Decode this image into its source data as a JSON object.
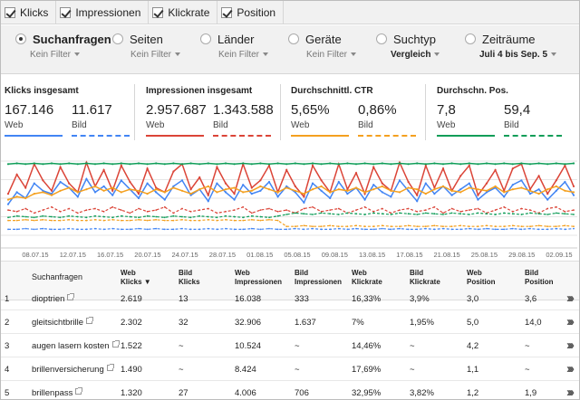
{
  "metrics": [
    {
      "label": "Klicks",
      "checked": true
    },
    {
      "label": "Impressionen",
      "checked": true
    },
    {
      "label": "Klickrate",
      "checked": true
    },
    {
      "label": "Position",
      "checked": true
    }
  ],
  "dimensions": [
    {
      "label": "Suchanfragen",
      "sub": "Kein Filter",
      "selected": true
    },
    {
      "label": "Seiten",
      "sub": "Kein Filter",
      "selected": false
    },
    {
      "label": "Länder",
      "sub": "Kein Filter",
      "selected": false
    },
    {
      "label": "Geräte",
      "sub": "Kein Filter",
      "selected": false
    },
    {
      "label": "Suchtyp",
      "sub": "Vergleich",
      "selected": false
    },
    {
      "label": "Zeiträume",
      "sub": "Juli 4 bis Sep. 5",
      "selected": false
    }
  ],
  "summary": [
    {
      "title": "Klicks insgesamt",
      "web": "167.146",
      "bild": "11.617",
      "web_label": "Web",
      "bild_label": "Bild",
      "color": "#4285f4"
    },
    {
      "title": "Impressionen insgesamt",
      "web": "2.957.687",
      "bild": "1.343.588",
      "web_label": "Web",
      "bild_label": "Bild",
      "color": "#db4437"
    },
    {
      "title": "Durchschnittl. CTR",
      "web": "5,65%",
      "bild": "0,86%",
      "web_label": "Web",
      "bild_label": "Bild",
      "color": "#f4a01f"
    },
    {
      "title": "Durchschn. Pos.",
      "web": "7,8",
      "bild": "59,4",
      "web_label": "Web",
      "bild_label": "Bild",
      "color": "#0f9d58"
    }
  ],
  "chart_data": {
    "type": "line",
    "categories": [
      "08.07.15",
      "12.07.15",
      "16.07.15",
      "20.07.15",
      "24.07.15",
      "28.07.15",
      "01.08.15",
      "05.08.15",
      "09.08.15",
      "13.08.15",
      "17.08.15",
      "21.08.15",
      "25.08.15",
      "29.08.15",
      "02.09.15"
    ],
    "series": [
      {
        "name": "Klicks Web",
        "color": "#4285f4",
        "style": "solid",
        "values": [
          42,
          58,
          50,
          70,
          60,
          56,
          72,
          64,
          52,
          76,
          58,
          66,
          54,
          74,
          62,
          50,
          70,
          58,
          48,
          66,
          74,
          54,
          62,
          46,
          70,
          58,
          48,
          68,
          56,
          60,
          72,
          52,
          66,
          58,
          44,
          70,
          60,
          50,
          72,
          56,
          64,
          48,
          68,
          58,
          52,
          74,
          60,
          46,
          70,
          56,
          66,
          54,
          62,
          70,
          48,
          58,
          64,
          52,
          68,
          74,
          56,
          62,
          48,
          60,
          72,
          54
        ]
      },
      {
        "name": "Klicks Bild",
        "color": "#4285f4",
        "style": "dashed",
        "values": [
          8,
          8,
          9,
          8,
          9,
          8,
          8,
          9,
          8,
          8,
          9,
          8,
          9,
          8,
          8,
          9,
          8,
          9,
          8,
          8,
          9,
          8,
          8,
          9,
          8,
          9,
          8,
          8,
          9,
          8,
          9,
          8,
          8,
          9,
          8,
          9,
          8,
          8,
          9,
          8,
          9,
          8,
          8,
          9,
          8,
          9,
          8,
          8,
          9,
          8,
          9,
          8,
          8,
          9,
          8,
          9,
          8,
          8,
          9,
          8,
          9,
          8,
          8,
          9,
          8,
          9
        ]
      },
      {
        "name": "Impressionen Web",
        "color": "#db4437",
        "style": "solid",
        "values": [
          56,
          82,
          64,
          96,
          74,
          60,
          92,
          70,
          58,
          98,
          66,
          88,
          60,
          94,
          72,
          56,
          90,
          64,
          58,
          86,
          96,
          62,
          78,
          54,
          92,
          70,
          56,
          96,
          64,
          74,
          94,
          58,
          88,
          66,
          52,
          94,
          74,
          58,
          96,
          62,
          84,
          56,
          92,
          70,
          60,
          98,
          72,
          54,
          94,
          64,
          90,
          60,
          80,
          94,
          54,
          70,
          88,
          60,
          90,
          96,
          62,
          80,
          56,
          74,
          94,
          66
        ]
      },
      {
        "name": "Impressionen Bild",
        "color": "#db4437",
        "style": "dashed",
        "values": [
          34,
          32,
          36,
          30,
          34,
          38,
          32,
          36,
          30,
          34,
          36,
          32,
          38,
          34,
          30,
          36,
          32,
          34,
          38,
          30,
          36,
          32,
          34,
          36,
          30,
          32,
          34,
          38,
          30,
          34,
          36,
          32,
          34,
          30,
          36,
          38,
          32,
          34,
          36,
          30,
          34,
          38,
          32,
          36,
          30,
          34,
          36,
          32,
          34,
          38,
          30,
          36,
          32,
          34,
          36,
          30,
          34,
          38,
          32,
          36,
          34,
          30,
          36,
          38,
          32,
          34
        ]
      },
      {
        "name": "CTR Web",
        "color": "#f4a01f",
        "style": "solid",
        "values": [
          48,
          52,
          50,
          56,
          58,
          54,
          60,
          64,
          58,
          62,
          66,
          60,
          64,
          58,
          62,
          60,
          56,
          62,
          58,
          64,
          60,
          56,
          62,
          66,
          58,
          62,
          64,
          58,
          60,
          66,
          62,
          58,
          64,
          60,
          56,
          62,
          66,
          58,
          62,
          60,
          64,
          58,
          62,
          66,
          60,
          58,
          64,
          62,
          56,
          62,
          66,
          60,
          58,
          64,
          62,
          60,
          66,
          58,
          62,
          64,
          60,
          56,
          62,
          66,
          60,
          58
        ]
      },
      {
        "name": "CTR Bild",
        "color": "#f4a01f",
        "style": "dashed",
        "values": [
          20,
          20,
          21,
          20,
          21,
          20,
          20,
          21,
          20,
          20,
          21,
          20,
          21,
          20,
          20,
          21,
          20,
          21,
          20,
          20,
          21,
          20,
          20,
          21,
          20,
          21,
          20,
          20,
          21,
          20,
          21,
          20,
          12,
          12,
          13,
          12,
          12,
          13,
          12,
          12,
          13,
          12,
          12,
          13,
          12,
          12,
          13,
          12,
          12,
          13,
          12,
          12,
          13,
          12,
          12,
          13,
          12,
          12,
          13,
          12,
          12,
          13,
          12,
          12,
          13,
          12
        ]
      },
      {
        "name": "Position Web",
        "color": "#0f9d58",
        "style": "solid",
        "values": [
          96,
          97,
          96,
          97,
          96,
          97,
          96,
          97,
          96,
          97,
          96,
          97,
          96,
          97,
          96,
          97,
          96,
          97,
          96,
          97,
          96,
          97,
          96,
          97,
          96,
          97,
          96,
          97,
          96,
          97,
          96,
          97,
          96,
          97,
          96,
          97,
          96,
          97,
          96,
          97,
          96,
          97,
          96,
          97,
          96,
          97,
          96,
          97,
          96,
          97,
          96,
          97,
          96,
          97,
          96,
          97,
          96,
          97,
          96,
          97,
          96,
          97,
          96,
          97,
          96,
          97
        ]
      },
      {
        "name": "Position Bild",
        "color": "#0f9d58",
        "style": "dashed",
        "values": [
          24,
          26,
          25,
          24,
          26,
          25,
          24,
          26,
          25,
          24,
          26,
          25,
          24,
          26,
          25,
          24,
          26,
          25,
          24,
          26,
          25,
          24,
          26,
          25,
          24,
          26,
          25,
          24,
          26,
          25,
          24,
          26,
          28,
          30,
          29,
          28,
          30,
          29,
          28,
          30,
          29,
          28,
          30,
          29,
          28,
          30,
          29,
          28,
          30,
          29,
          28,
          30,
          29,
          28,
          30,
          29,
          28,
          30,
          29,
          28,
          30,
          29,
          28,
          30,
          29,
          28
        ]
      }
    ],
    "ylim": [
      0,
      100
    ],
    "grid": true
  },
  "table": {
    "headers": [
      {
        "label": "Suchanfragen",
        "bold": false
      },
      {
        "label": "Web\nKlicks ▼",
        "bold": true
      },
      {
        "label": "Bild\nKlicks",
        "bold": true
      },
      {
        "label": "Web\nImpressionen",
        "bold": true
      },
      {
        "label": "Bild\nImpressionen",
        "bold": true
      },
      {
        "label": "Web\nKlickrate",
        "bold": true
      },
      {
        "label": "Bild\nKlickrate",
        "bold": true
      },
      {
        "label": "Web\nPosition",
        "bold": true
      },
      {
        "label": "Bild\nPosition",
        "bold": true
      }
    ],
    "rows": [
      {
        "n": "1",
        "query": "dioptrien",
        "web_klicks": "2.619",
        "bild_klicks": "13",
        "web_impr": "16.038",
        "bild_impr": "333",
        "web_ctr": "16,33%",
        "bild_ctr": "3,9%",
        "web_pos": "3,0",
        "bild_pos": "3,6"
      },
      {
        "n": "2",
        "query": "gleitsichtbrille",
        "web_klicks": "2.302",
        "bild_klicks": "32",
        "web_impr": "32.906",
        "bild_impr": "1.637",
        "web_ctr": "7%",
        "bild_ctr": "1,95%",
        "web_pos": "5,0",
        "bild_pos": "14,0"
      },
      {
        "n": "3",
        "query": "augen lasern kosten",
        "web_klicks": "1.522",
        "bild_klicks": "~",
        "web_impr": "10.524",
        "bild_impr": "~",
        "web_ctr": "14,46%",
        "bild_ctr": "~",
        "web_pos": "4,2",
        "bild_pos": "~"
      },
      {
        "n": "4",
        "query": "brillenversicherung",
        "web_klicks": "1.490",
        "bild_klicks": "~",
        "web_impr": "8.424",
        "bild_impr": "~",
        "web_ctr": "17,69%",
        "bild_ctr": "~",
        "web_pos": "1,1",
        "bild_pos": "~"
      },
      {
        "n": "5",
        "query": "brillenpass",
        "web_klicks": "1.320",
        "bild_klicks": "27",
        "web_impr": "4.006",
        "bild_impr": "706",
        "web_ctr": "32,95%",
        "bild_ctr": "3,82%",
        "web_pos": "1,2",
        "bild_pos": "1,9"
      }
    ]
  }
}
